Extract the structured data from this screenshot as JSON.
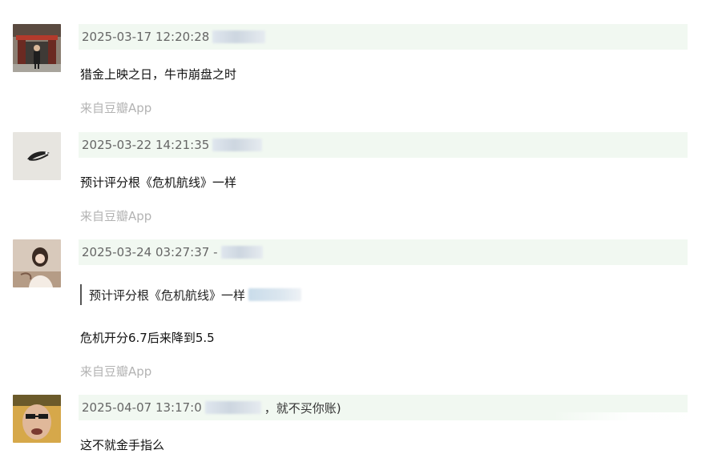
{
  "comments": [
    {
      "timestamp": "2025-03-17 12:20:28",
      "text": "猎金上映之日，牛市崩盘之时",
      "source": "来自豆瓣App"
    },
    {
      "timestamp": "2025-03-22 14:21:35",
      "text": "预计评分根《危机航线》一样",
      "source": "来自豆瓣App"
    },
    {
      "timestamp": "2025-03-24 03:27:37 -",
      "quote": "预计评分根《危机航线》一样",
      "text": "危机开分6.7后来降到5.5",
      "source": "来自豆瓣App"
    },
    {
      "timestamp": "2025-04-07 13:17:0",
      "meta_extra": "，就不买你账)",
      "text": "这不就金手指么"
    }
  ]
}
